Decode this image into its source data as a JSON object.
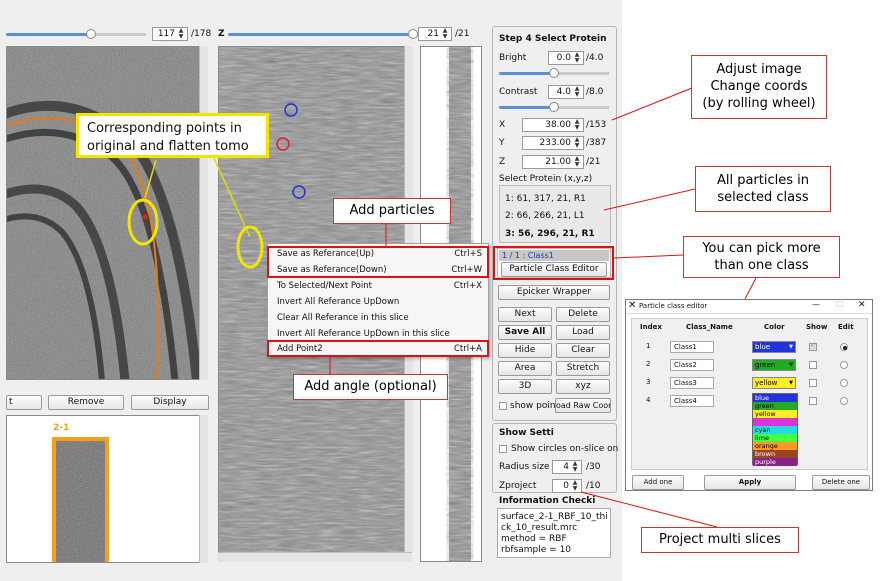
{
  "toolbar": {
    "slice1_value": "117",
    "slice1_max": "/178",
    "z_label": "Z",
    "slice2_value": "21",
    "slice2_max": "/21"
  },
  "left_panel": {
    "buttons": [
      "t",
      "Remove",
      "Display"
    ],
    "thumb_label": "2-1"
  },
  "context_menu": {
    "items": [
      {
        "label": "Save as Referance(Up)",
        "shortcut": "Ctrl+S"
      },
      {
        "label": "Save as Referance(Down)",
        "shortcut": "Ctrl+W"
      },
      {
        "label": "To Selected/Next Point",
        "shortcut": "Ctrl+X"
      },
      {
        "label": "Invert All Referance UpDown",
        "shortcut": ""
      },
      {
        "label": "Clear All Referance in this slice",
        "shortcut": ""
      },
      {
        "label": "Invert All Referance UpDown in this slice",
        "shortcut": ""
      },
      {
        "label": "Add Point2",
        "shortcut": "Ctrl+A"
      }
    ]
  },
  "step_panel": {
    "title": "Step 4 Select Protein",
    "bright_label": "Bright",
    "bright_value": "0.0",
    "bright_max": "/4.0",
    "bright_level": 0.5,
    "contrast_label": "Contrast",
    "contrast_value": "4.0",
    "contrast_max": "/8.0",
    "contrast_level": 0.5,
    "x_label": "X",
    "x_value": "38.00",
    "x_max": "/153",
    "y_label": "Y",
    "y_value": "233.00",
    "y_max": "/387",
    "z_label": "Z",
    "z_value": "21.00",
    "z_max": "/21",
    "select_protein_label": "Select Protein (x,y,z)",
    "proteins": [
      "1: 61, 317, 21, R1",
      "2: 66, 266, 21, L1",
      "3: 56, 296, 21, R1"
    ],
    "class_item": "1 / 1 : Class1",
    "class_editor_button": "Particle Class Editor",
    "epicker_button": "Epicker Wrapper",
    "buttons": [
      "Next",
      "Delete",
      "Save All",
      "Load",
      "Hide",
      "Clear",
      "Area",
      "Stretch",
      "3D",
      "xyz"
    ],
    "show_point_label": "show poin",
    "load_raw_button": "oad Raw Coor"
  },
  "show_settings": {
    "title": "Show Setti",
    "circles_label": "Show circles on-slice on",
    "radius_label": "Radius size",
    "radius_value": "4",
    "radius_max": "/30",
    "zproject_label": "Zproject",
    "zproject_value": "0",
    "zproject_max": "/10"
  },
  "info": {
    "title": "Information Checki",
    "lines": [
      "surface_2-1_RBF_10_thi",
      "ck_10_result.mrc",
      "method = RBF",
      "rbfsample = 10"
    ]
  },
  "annotations": {
    "corresponding": "Corresponding points in original and flatten tomo",
    "add_particles": "Add particles",
    "add_angle": "Add angle (optional)",
    "adjust_image": [
      "Adjust image",
      "Change coords",
      "(by rolling wheel)"
    ],
    "all_particles": [
      "All particles in",
      "selected class"
    ],
    "pick_more": [
      "You can pick more",
      "than one class"
    ],
    "project_multi": "Project multi slices"
  },
  "class_editor": {
    "title": "Particle class editor",
    "headers": [
      "Index",
      "Class_Name",
      "Color",
      "Show",
      "Edit"
    ],
    "rows": [
      {
        "index": "1",
        "name": "Class1",
        "color": "blue",
        "color_hex": "#2233dd",
        "show": true,
        "edit": true
      },
      {
        "index": "2",
        "name": "Class2",
        "color": "green",
        "color_hex": "#22aa22",
        "show": false,
        "edit": false
      },
      {
        "index": "3",
        "name": "Class3",
        "color": "yellow",
        "color_hex": "#ffee22",
        "show": false,
        "edit": false
      },
      {
        "index": "4",
        "name": "Class4",
        "color": "",
        "color_hex": "#ffffff",
        "show": false,
        "edit": false
      }
    ],
    "color_list": [
      {
        "name": "blue",
        "hex": "#2233dd"
      },
      {
        "name": "green",
        "hex": "#22aa22"
      },
      {
        "name": "yellow",
        "hex": "#ffee22"
      },
      {
        "name": "",
        "hex": "#dd33dd"
      },
      {
        "name": "cyan",
        "hex": "#22dddd"
      },
      {
        "name": "lime",
        "hex": "#44ff44"
      },
      {
        "name": "orange",
        "hex": "#ff9922"
      },
      {
        "name": "brown",
        "hex": "#994422"
      },
      {
        "name": "purple",
        "hex": "#882288"
      }
    ],
    "buttons": [
      "Add one",
      "Apply",
      "Delete one"
    ]
  }
}
